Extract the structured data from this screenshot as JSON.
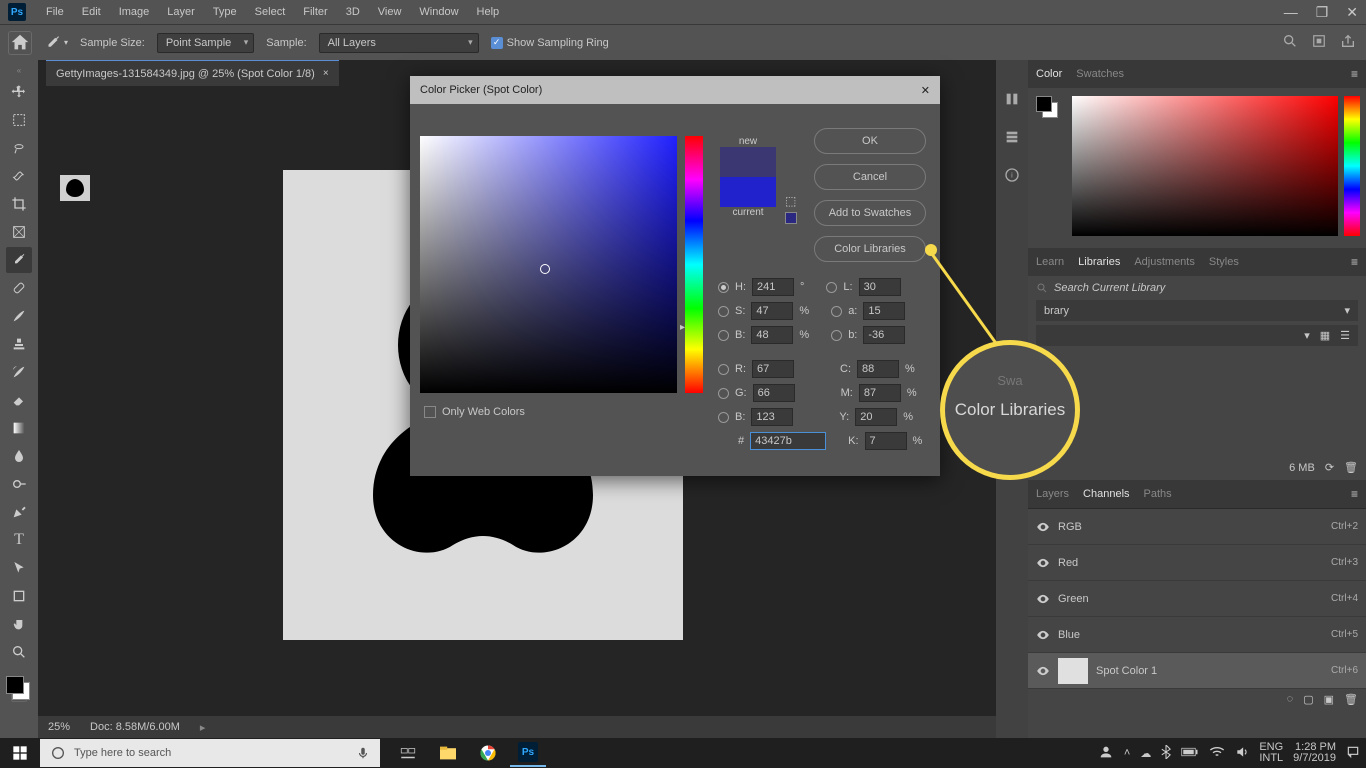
{
  "menu": {
    "items": [
      "File",
      "Edit",
      "Image",
      "Layer",
      "Type",
      "Select",
      "Filter",
      "3D",
      "View",
      "Window",
      "Help"
    ]
  },
  "options_bar": {
    "sample_size_label": "Sample Size:",
    "sample_size_value": "Point Sample",
    "sample_label": "Sample:",
    "sample_value": "All Layers",
    "show_ring": "Show Sampling Ring"
  },
  "document": {
    "tab_title": "GettyImages-131584349.jpg @ 25% (Spot Color 1/8)",
    "zoom": "25%",
    "doc_size": "Doc: 8.58M/6.00M"
  },
  "dialog": {
    "title": "Color Picker (Spot Color)",
    "new_label": "new",
    "current_label": "current",
    "btn_ok": "OK",
    "btn_cancel": "Cancel",
    "btn_add": "Add to Swatches",
    "btn_lib": "Color Libraries",
    "only_web": "Only Web Colors",
    "H": "241",
    "S": "47",
    "Bv": "48",
    "L": "30",
    "a": "15",
    "b": "-36",
    "R": "67",
    "G": "66",
    "Bb": "123",
    "C": "88",
    "M": "87",
    "Y": "20",
    "K": "7",
    "hex": "43427b",
    "deg": "°",
    "pct": "%"
  },
  "panels": {
    "color_tabs": [
      "Color",
      "Swatches"
    ],
    "lib_tabs": [
      "Learn",
      "Libraries",
      "Adjustments",
      "Styles"
    ],
    "lib_search": "Search Current Library",
    "lib_dd": "brary",
    "lib_size": "6 MB",
    "chan_tabs": [
      "Layers",
      "Channels",
      "Paths"
    ],
    "channels": [
      {
        "name": "RGB",
        "key": "Ctrl+2"
      },
      {
        "name": "Red",
        "key": "Ctrl+3"
      },
      {
        "name": "Green",
        "key": "Ctrl+4"
      },
      {
        "name": "Blue",
        "key": "Ctrl+5"
      },
      {
        "name": "Spot Color 1",
        "key": "Ctrl+6"
      }
    ]
  },
  "callout": {
    "text": "Color Libraries",
    "faint": "Swa"
  },
  "taskbar": {
    "search": "Type here to search",
    "lang1": "ENG",
    "lang2": "INTL",
    "time": "1:28 PM",
    "date": "9/7/2019"
  }
}
